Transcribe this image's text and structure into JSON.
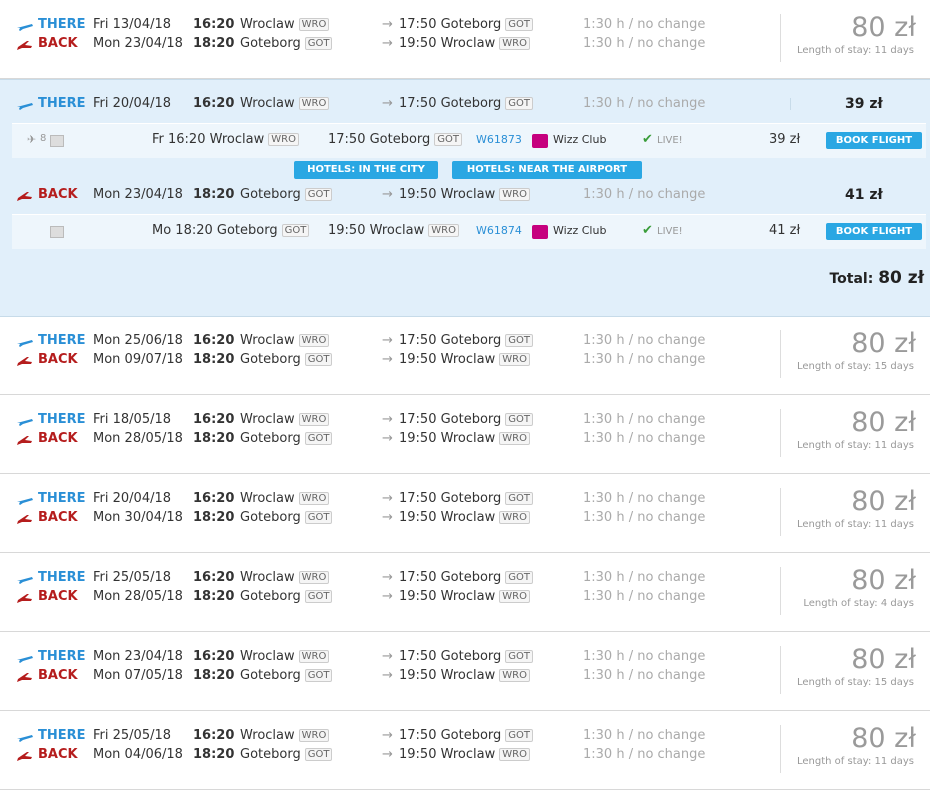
{
  "labels": {
    "there": "THERE",
    "back": "BACK",
    "arrow": "→",
    "book": "BOOK FLIGHT",
    "live": "LIVE!",
    "check": "✔"
  },
  "colors": {
    "accent": "#2a8fd6",
    "back": "#b51d1d",
    "button": "#2aa7e3",
    "expanded_bg": "#e1effa"
  },
  "rows": [
    {
      "there": {
        "date": "Fri 13/04/18",
        "dep_time": "16:20",
        "dep_city": "Wroclaw",
        "dep_code": "WRO",
        "arr_time": "17:50",
        "arr_city": "Goteborg",
        "arr_code": "GOT",
        "duration": "1:30 h / no change"
      },
      "back": {
        "date": "Mon 23/04/18",
        "dep_time": "18:20",
        "dep_city": "Goteborg",
        "dep_code": "GOT",
        "arr_time": "19:50",
        "arr_city": "Wroclaw",
        "arr_code": "WRO",
        "duration": "1:30 h / no change"
      },
      "price": "80 zł",
      "stay": "Length of stay: 11 days"
    },
    {
      "there": {
        "date": "Mon 25/06/18",
        "dep_time": "16:20",
        "dep_city": "Wroclaw",
        "dep_code": "WRO",
        "arr_time": "17:50",
        "arr_city": "Goteborg",
        "arr_code": "GOT",
        "duration": "1:30 h / no change"
      },
      "back": {
        "date": "Mon 09/07/18",
        "dep_time": "18:20",
        "dep_city": "Goteborg",
        "dep_code": "GOT",
        "arr_time": "19:50",
        "arr_city": "Wroclaw",
        "arr_code": "WRO",
        "duration": "1:30 h / no change"
      },
      "price": "80 zł",
      "stay": "Length of stay: 15 days"
    },
    {
      "there": {
        "date": "Fri 18/05/18",
        "dep_time": "16:20",
        "dep_city": "Wroclaw",
        "dep_code": "WRO",
        "arr_time": "17:50",
        "arr_city": "Goteborg",
        "arr_code": "GOT",
        "duration": "1:30 h / no change"
      },
      "back": {
        "date": "Mon 28/05/18",
        "dep_time": "18:20",
        "dep_city": "Goteborg",
        "dep_code": "GOT",
        "arr_time": "19:50",
        "arr_city": "Wroclaw",
        "arr_code": "WRO",
        "duration": "1:30 h / no change"
      },
      "price": "80 zł",
      "stay": "Length of stay: 11 days"
    },
    {
      "there": {
        "date": "Fri 20/04/18",
        "dep_time": "16:20",
        "dep_city": "Wroclaw",
        "dep_code": "WRO",
        "arr_time": "17:50",
        "arr_city": "Goteborg",
        "arr_code": "GOT",
        "duration": "1:30 h / no change"
      },
      "back": {
        "date": "Mon 30/04/18",
        "dep_time": "18:20",
        "dep_city": "Goteborg",
        "dep_code": "GOT",
        "arr_time": "19:50",
        "arr_city": "Wroclaw",
        "arr_code": "WRO",
        "duration": "1:30 h / no change"
      },
      "price": "80 zł",
      "stay": "Length of stay: 11 days"
    },
    {
      "there": {
        "date": "Fri 25/05/18",
        "dep_time": "16:20",
        "dep_city": "Wroclaw",
        "dep_code": "WRO",
        "arr_time": "17:50",
        "arr_city": "Goteborg",
        "arr_code": "GOT",
        "duration": "1:30 h / no change"
      },
      "back": {
        "date": "Mon 28/05/18",
        "dep_time": "18:20",
        "dep_city": "Goteborg",
        "dep_code": "GOT",
        "arr_time": "19:50",
        "arr_city": "Wroclaw",
        "arr_code": "WRO",
        "duration": "1:30 h / no change"
      },
      "price": "80 zł",
      "stay": "Length of stay: 4 days"
    },
    {
      "there": {
        "date": "Mon 23/04/18",
        "dep_time": "16:20",
        "dep_city": "Wroclaw",
        "dep_code": "WRO",
        "arr_time": "17:50",
        "arr_city": "Goteborg",
        "arr_code": "GOT",
        "duration": "1:30 h / no change"
      },
      "back": {
        "date": "Mon 07/05/18",
        "dep_time": "18:20",
        "dep_city": "Goteborg",
        "dep_code": "GOT",
        "arr_time": "19:50",
        "arr_city": "Wroclaw",
        "arr_code": "WRO",
        "duration": "1:30 h / no change"
      },
      "price": "80 zł",
      "stay": "Length of stay: 15 days"
    },
    {
      "there": {
        "date": "Fri 25/05/18",
        "dep_time": "16:20",
        "dep_city": "Wroclaw",
        "dep_code": "WRO",
        "arr_time": "17:50",
        "arr_city": "Goteborg",
        "arr_code": "GOT",
        "duration": "1:30 h / no change"
      },
      "back": {
        "date": "Mon 04/06/18",
        "dep_time": "18:20",
        "dep_city": "Goteborg",
        "dep_code": "GOT",
        "arr_time": "19:50",
        "arr_city": "Wroclaw",
        "arr_code": "WRO",
        "duration": "1:30 h / no change"
      },
      "price": "80 zł",
      "stay": "Length of stay: 11 days"
    }
  ],
  "expanded": {
    "there": {
      "date": "Fri 20/04/18",
      "dep_time": "16:20",
      "dep_city": "Wroclaw",
      "dep_code": "WRO",
      "arr_time": "17:50",
      "arr_city": "Goteborg",
      "arr_code": "GOT",
      "duration": "1:30 h / no change",
      "price": "39 zł"
    },
    "there_detail": {
      "seat_count": "8",
      "dep": "Fr 16:20 Wroclaw",
      "dep_code": "WRO",
      "arr": "17:50 Goteborg",
      "arr_code": "GOT",
      "flight_no": "W61873",
      "airline": "Wizz Club",
      "price": "39 zł"
    },
    "hotels": {
      "city": "HOTELS: IN THE CITY",
      "airport": "HOTELS: NEAR THE AIRPORT"
    },
    "back": {
      "date": "Mon 23/04/18",
      "dep_time": "18:20",
      "dep_city": "Goteborg",
      "dep_code": "GOT",
      "arr_time": "19:50",
      "arr_city": "Wroclaw",
      "arr_code": "WRO",
      "duration": "1:30 h / no change",
      "price": "41 zł"
    },
    "back_detail": {
      "dep": "Mo 18:20 Goteborg",
      "dep_code": "GOT",
      "arr": "19:50 Wroclaw",
      "arr_code": "WRO",
      "flight_no": "W61874",
      "airline": "Wizz Club",
      "price": "41 zł"
    },
    "total_label": "Total:",
    "total": "80 zł"
  }
}
